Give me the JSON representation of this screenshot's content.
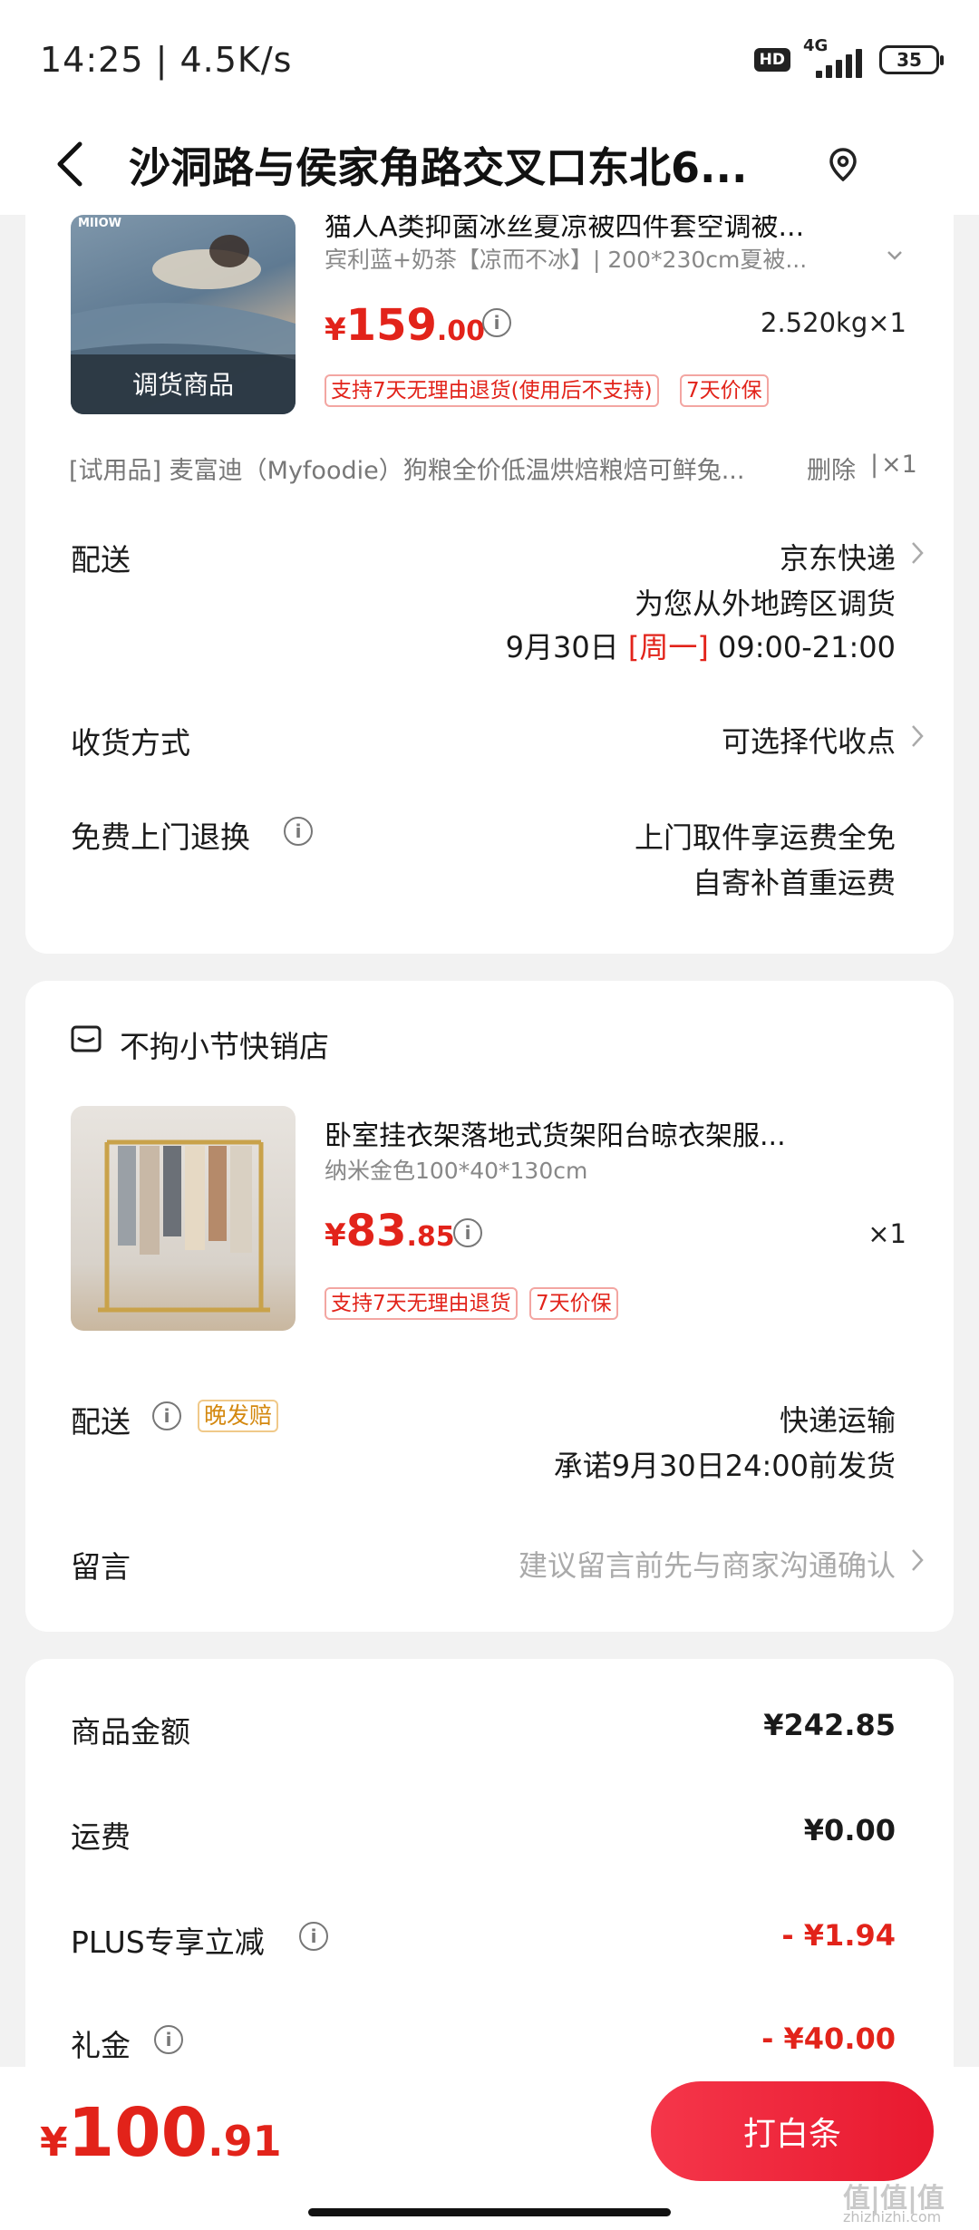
{
  "status_bar": {
    "time": "14:25 | 4.5K/s",
    "hd": "HD",
    "network": "4G",
    "battery": "35"
  },
  "header": {
    "title": "沙洞路与侯家角路交叉口东北6..."
  },
  "product1": {
    "thumb_overlay": "调货商品",
    "thumb_brand": "MIIOW",
    "name": "猫人A类抑菌冰丝夏凉被四件套空调被...",
    "spec": "宾利蓝+奶茶【凉而不冰】| 200*230cm夏被...",
    "price_symbol": "¥",
    "price_int": "159",
    "price_dec": ".00",
    "weight_qty": "2.520kg×1",
    "tags": [
      "支持7天无理由退货(使用后不支持)",
      "7天价保"
    ]
  },
  "trial": {
    "text": "[试用品]  麦富迪（Myfoodie）狗粮全价低温烘焙粮焙可鲜兔...",
    "delete": "删除",
    "sep": "|",
    "qty": "×1"
  },
  "delivery1": {
    "label": "配送",
    "carrier": "京东快递",
    "note": "为您从外地跨区调货",
    "date": "9月30日",
    "weekday": "[周一]",
    "time": "09:00-21:00"
  },
  "receive": {
    "label": "收货方式",
    "value": "可选择代收点"
  },
  "free_return": {
    "label": "免费上门退换",
    "line1": "上门取件享运费全免",
    "line2": "自寄补首重运费"
  },
  "store": {
    "name": "不拘小节快销店"
  },
  "product2": {
    "name": "卧室挂衣架落地式货架阳台晾衣架服...",
    "spec": "纳米金色100*40*130cm",
    "price_symbol": "¥",
    "price_int": "83",
    "price_dec": ".85",
    "qty": "×1",
    "tags": [
      "支持7天无理由退货",
      "7天价保"
    ]
  },
  "delivery2": {
    "label": "配送",
    "badge": "晚发赔",
    "carrier": "快递运输",
    "promise": "承诺9月30日24:00前发货"
  },
  "message": {
    "label": "留言",
    "placeholder": "建议留言前先与商家沟通确认"
  },
  "summary": {
    "goods_label": "商品金额",
    "goods_value": "¥242.85",
    "shipping_label": "运费",
    "shipping_value": "¥0.00",
    "plus_label": "PLUS专享立减",
    "plus_value": "- ¥1.94",
    "gift_label": "礼金",
    "gift_value": "- ¥40.00"
  },
  "bottom": {
    "total_symbol": "¥",
    "total_int": "100",
    "total_dec": ".91",
    "pay_button": "打白条"
  },
  "watermark": {
    "main": "值|值|值",
    "sub": "zhizhizhi.com"
  },
  "colors": {
    "accent_red": "#e2231a",
    "background": "#f2f2f2",
    "card": "#ffffff"
  }
}
